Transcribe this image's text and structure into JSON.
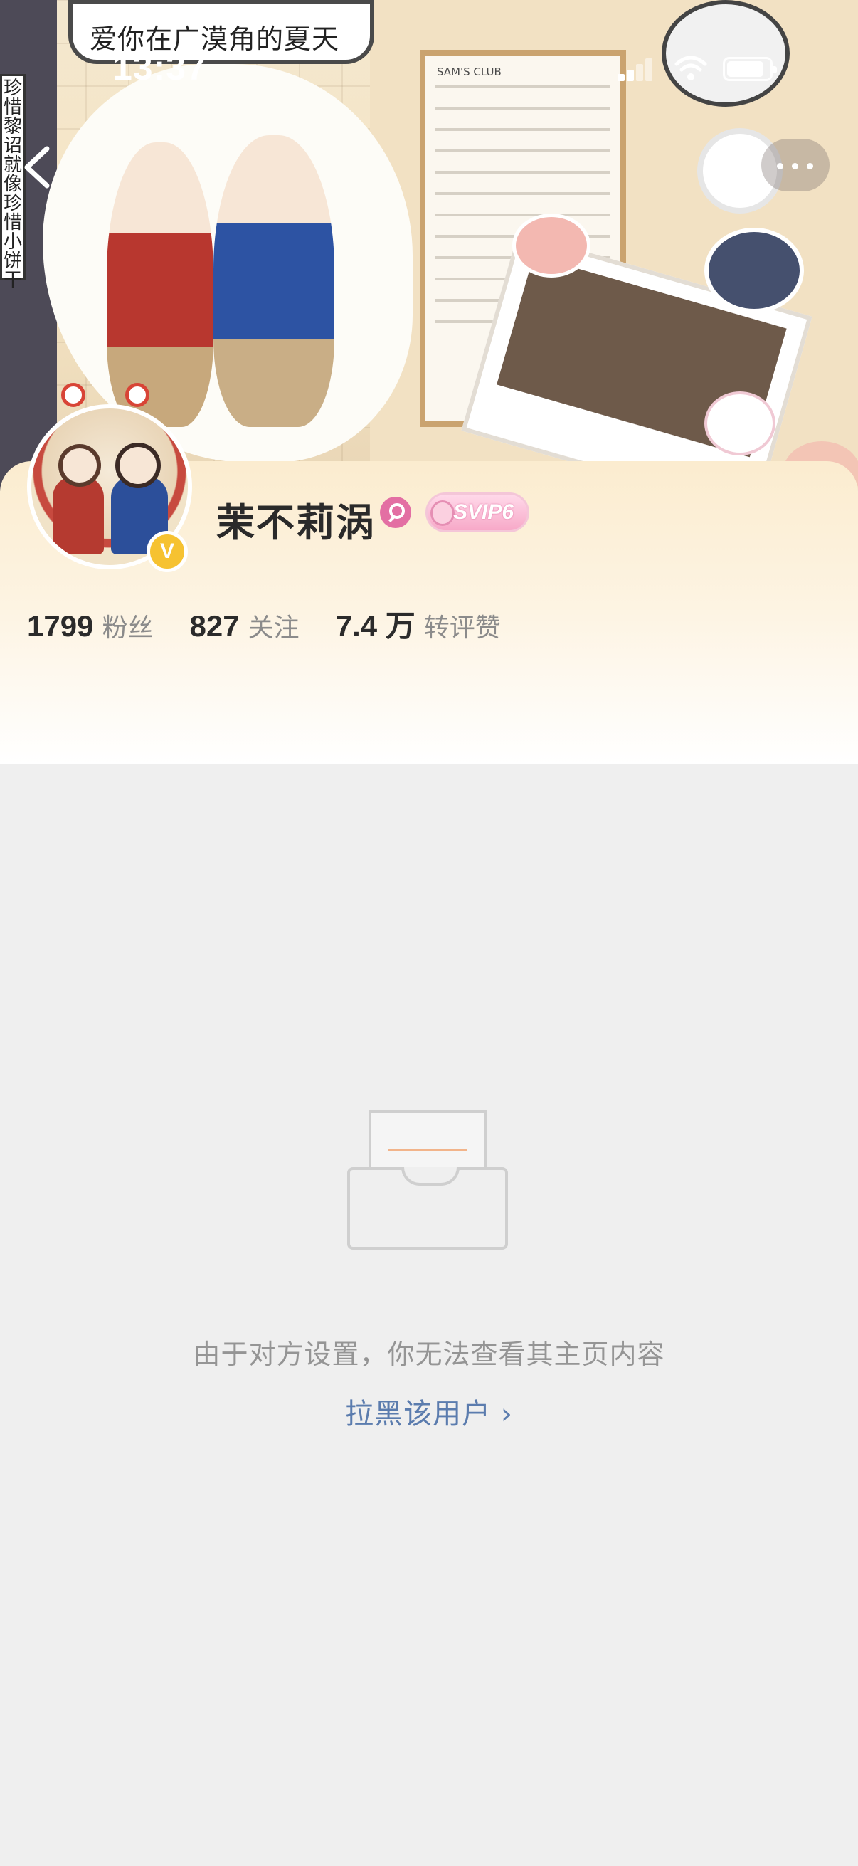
{
  "status_bar": {
    "time": "13:37"
  },
  "cover": {
    "bubble_text": "爱你在广漠角的夏天",
    "side_note": "珍惜黎诏就像珍惜小饼干",
    "receipt_title": "SAM'S CLUB"
  },
  "nav": {
    "back_icon": "chevron-left-icon",
    "more_icon": "more-dots-icon"
  },
  "profile": {
    "name": "茉不莉涡",
    "gender_icon": "female-icon",
    "vip_badge": "SVIP6",
    "verified_badge": "V",
    "stats": [
      {
        "value": "1799",
        "label": "粉丝"
      },
      {
        "value": "827",
        "label": "关注"
      },
      {
        "value": "7.4 万",
        "label": "转评赞"
      }
    ]
  },
  "empty_state": {
    "icon": "empty-inbox-icon",
    "message": "由于对方设置，你无法查看其主页内容",
    "block_link": "拉黑该用户 ›"
  },
  "colors": {
    "background": "#efefef",
    "link": "#5b7cae",
    "verified": "#f6c231",
    "gender": "#e36fa3"
  }
}
